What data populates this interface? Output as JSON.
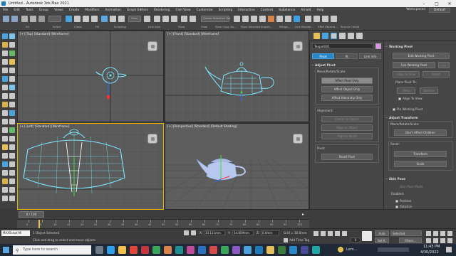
{
  "window": {
    "title": "Untitled - Autodesk 3ds Max 2021",
    "controls": [
      "–",
      "□",
      "✕"
    ]
  },
  "menu": {
    "items": [
      "File",
      "Edit",
      "Tools",
      "Group",
      "Views",
      "Create",
      "Modifiers",
      "Animation",
      "Graph Editors",
      "Rendering",
      "Civil View",
      "Customize",
      "Scripting",
      "Interactive",
      "Content",
      "Substance",
      "Arnold",
      "Help"
    ],
    "workspaces_label": "Workspaces:",
    "workspace_value": "Default"
  },
  "toolbar": {
    "labels": [
      "All",
      "Select",
      "Clone",
      "Fill",
      "Scripting",
      "Link Axis",
      "Save",
      "View",
      "Save Copy As...",
      "Save Selected",
      "Import...",
      "Merge...",
      "Link Render...",
      "XRef Objects...",
      "Source Collab"
    ],
    "create_selection_set": "Create Selection Set",
    "view_dropdown": "View"
  },
  "viewports": {
    "top": "[+] [Top] [Standard] [Wireframe]",
    "front": "[+] [Front] [Standard] [Wireframe]",
    "left": "[+] [Left] [Standard] [Wireframe]",
    "perspective": "[+] [Perspective] [Standard] [Default Shading]"
  },
  "command_panel": {
    "object_name": "Teapot001",
    "tabs": [
      "Pivot",
      "IK",
      "Link Info"
    ],
    "adjust_pivot": {
      "header": "Adjust Pivot",
      "move_rotate_scale": "Move/Rotate/Scale:",
      "affect_pivot_only": "Affect Pivot Only",
      "affect_object_only": "Affect Object Only",
      "affect_hierarchy_only": "Affect Hierarchy Only",
      "alignment": "Alignment:",
      "center_to_object": "Center to Object",
      "align_to_object": "Align to Object",
      "align_to_world": "Align to World",
      "pivot": "Pivot:",
      "reset_pivot": "Reset Pivot"
    }
  },
  "right_panel": {
    "working_pivot": {
      "header": "Working Pivot",
      "edit_working_pivot": "Edit Working Pivot",
      "use_working_pivot": "Use Working Pivot",
      "more": "...",
      "align_to_view": "Align To View",
      "reset": "Reset",
      "place_pivot_to": "Place Pivot To:",
      "view": "View",
      "surface": "Surface",
      "align_to_view_chk": "Align To View",
      "pin_working_pivot": "Pin Working Pivot"
    },
    "adjust_transform": {
      "header": "Adjust Transform",
      "move_rotate_scale": "Move/Rotate/Scale:",
      "dont_affect_children": "Don't Affect Children",
      "reset": "Reset:",
      "transform": "Transform",
      "scale": "Scale"
    },
    "skin_pose": {
      "header": "Skin Pose",
      "skin_pose_mode": "Skin Pose Mode",
      "enabled": "Enabled:",
      "position": "Position",
      "rotation": "Rotation"
    }
  },
  "timeline": {
    "frame_label": "0 / 100",
    "ticks": [
      "0",
      "5",
      "10",
      "15",
      "20",
      "25",
      "30",
      "35",
      "40",
      "45",
      "50",
      "55",
      "60",
      "65",
      "70",
      "75",
      "80",
      "85",
      "90",
      "95",
      "100"
    ]
  },
  "status": {
    "maxscript": "MAXScript Mi",
    "selected": "1 Object Selected",
    "prompt": "Click and drag to select and move objects",
    "x_label": "X:",
    "x": "33.111mm",
    "y_label": "Y:",
    "y": "54.859mm",
    "z_label": "Z:",
    "z": "0.0mm",
    "grid": "Grid = 10.0mm",
    "add_time_tag": "Add Time Tag",
    "auto": "Auto",
    "selected_dropdown": "Selected",
    "set_key": "Set K.",
    "filters": "Filters...",
    "frame_field": "0"
  },
  "taskbar": {
    "search_placeholder": "Type here to search",
    "time": "11:43 PM",
    "date": "4/30/2022",
    "weather": "Lem..."
  },
  "colors": {
    "accent_blue": "#2a88c8",
    "active_viewport": "#e9b500",
    "teapot_wire": "#7fe8ff",
    "grid": "#6b6b6b"
  }
}
